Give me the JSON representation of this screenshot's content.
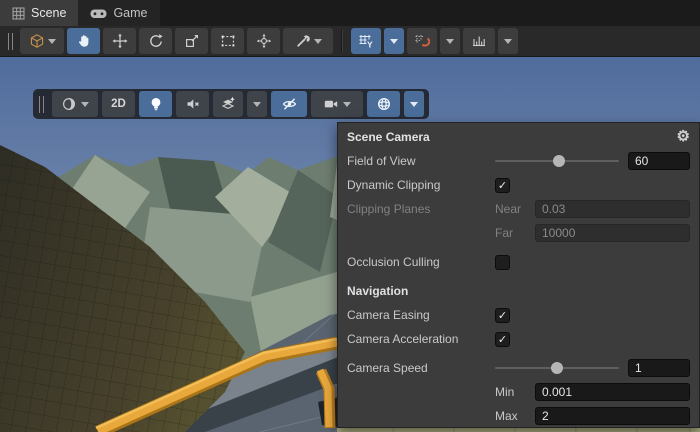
{
  "tab_bar": {
    "tabs": [
      {
        "label": "Scene",
        "icon": "grid-icon",
        "active": true
      },
      {
        "label": "Game",
        "icon": "gamepad-icon",
        "active": false
      }
    ]
  },
  "main_toolbar": {
    "tools": [
      "view-tool-menu",
      "hand-tool",
      "move-tool",
      "rotate-tool",
      "scale-tool",
      "rect-tool",
      "transform-tool",
      "custom-tools",
      "grid-visibility",
      "snap-toggle",
      "snap-increment"
    ],
    "active_tools": [
      "hand-tool",
      "grid-visibility"
    ],
    "grid_axis_label": "Y"
  },
  "scene_toolbar": {
    "buttons": [
      "draw-mode",
      "2d-view",
      "scene-lighting",
      "scene-audio",
      "effects",
      "hidden-objects",
      "scene-camera-settings",
      "gizmos-menu"
    ],
    "active_buttons": [
      "scene-lighting",
      "hidden-objects",
      "gizmos-menu"
    ],
    "label_2d": "2D"
  },
  "scene_camera_panel": {
    "title": "Scene Camera",
    "gear_glyph": "⚙",
    "field_of_view": {
      "label": "Field of View",
      "value": "60",
      "slider_percent": 52
    },
    "dynamic_clipping": {
      "label": "Dynamic Clipping",
      "checked": true,
      "check_glyph": "✓"
    },
    "clipping_planes": {
      "label": "Clipping Planes",
      "disabled": true,
      "near_label": "Near",
      "near_value": "0.03",
      "far_label": "Far",
      "far_value": "10000"
    },
    "occlusion_culling": {
      "label": "Occlusion Culling",
      "checked": false,
      "check_glyph": ""
    },
    "navigation_title": "Navigation",
    "camera_easing": {
      "label": "Camera Easing",
      "checked": true,
      "check_glyph": "✓"
    },
    "camera_acceleration": {
      "label": "Camera Acceleration",
      "checked": true,
      "check_glyph": "✓"
    },
    "camera_speed": {
      "label": "Camera Speed",
      "value": "1",
      "slider_percent": 50
    },
    "speed_min": {
      "label": "Min",
      "value": "0.001"
    },
    "speed_max": {
      "label": "Max",
      "value": "2"
    }
  },
  "colors": {
    "accent_blue": "#4a6e99",
    "rail_orange": "#e8a83c",
    "sky_top": "#506c9c",
    "sky_horizon": "#8397b6",
    "panel_bg": "#3c3c3c"
  }
}
